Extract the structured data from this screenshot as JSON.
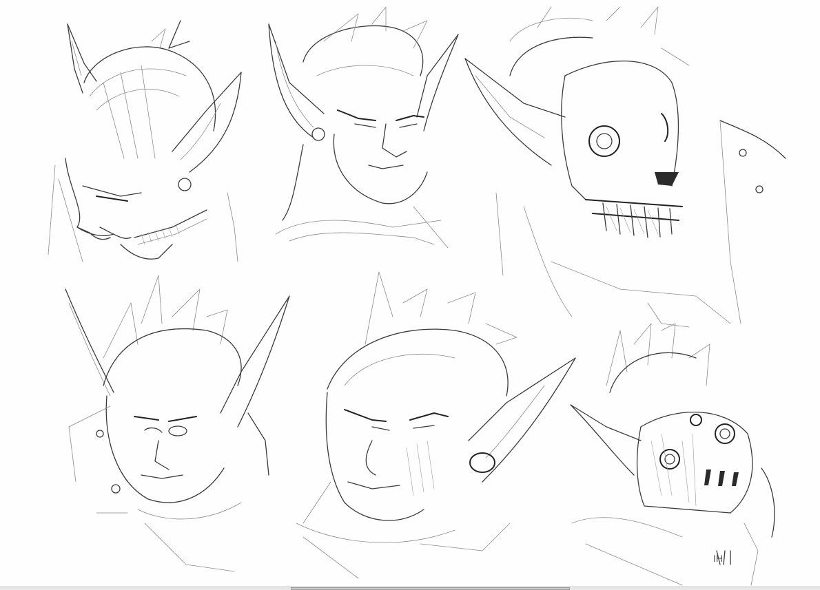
{
  "image": {
    "description_kind": "pencil sketch sheet",
    "background": "#ffffff",
    "line_color": "#3a3a3a"
  },
  "signature": "IH",
  "scrollbar": {
    "track_color": "#e8e8e8",
    "thumb_color": "#c9c9c9",
    "thumb_start_fraction": 0.355,
    "thumb_length_fraction": 0.34
  }
}
